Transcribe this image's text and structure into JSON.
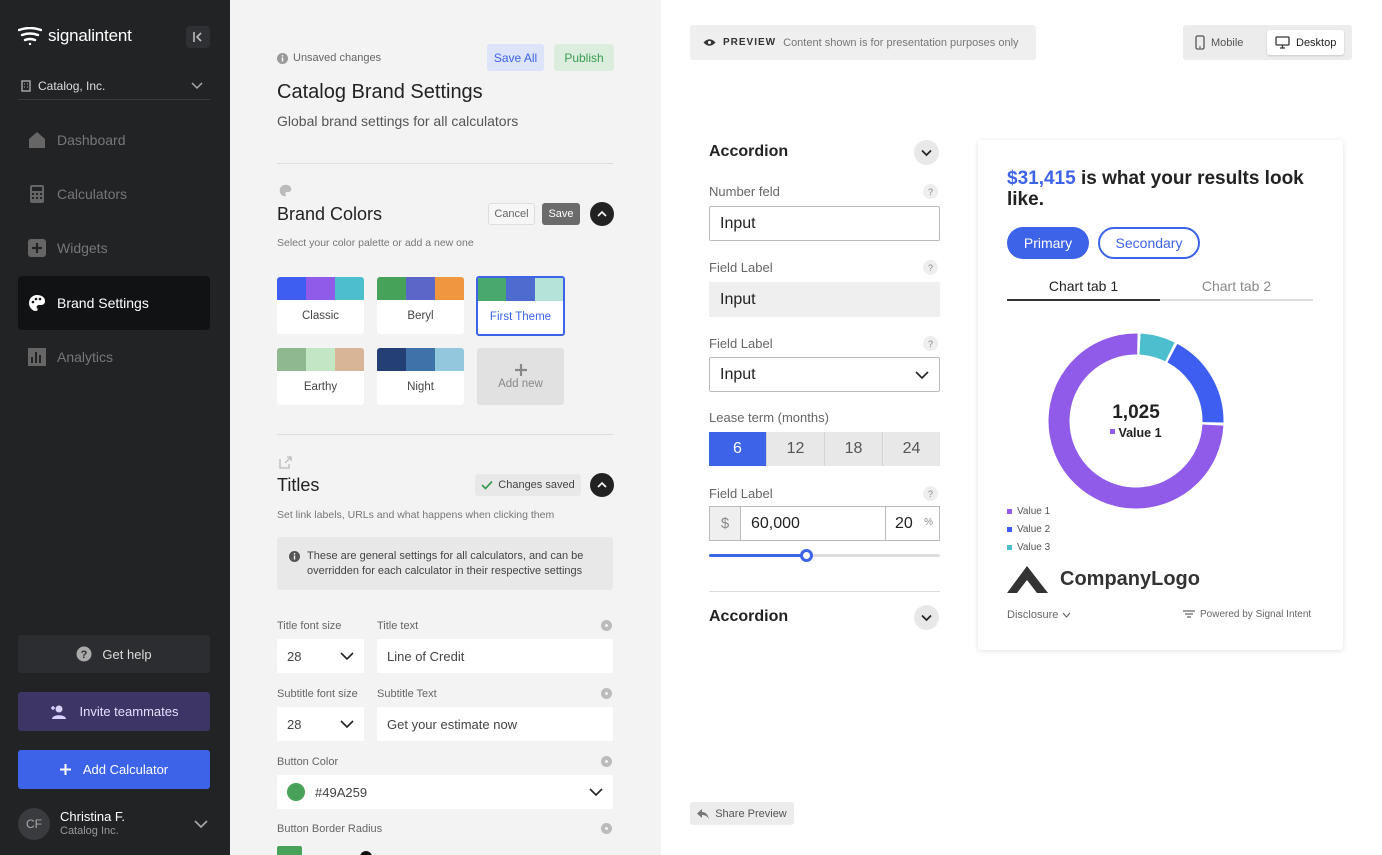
{
  "sidebar": {
    "logo_text": "signalintent",
    "org_name": "Catalog, Inc.",
    "nav": [
      {
        "label": "Dashboard",
        "icon": "home-icon"
      },
      {
        "label": "Calculators",
        "icon": "calculator-icon"
      },
      {
        "label": "Widgets",
        "icon": "plus-square-icon"
      },
      {
        "label": "Brand Settings",
        "icon": "palette-icon",
        "active": true
      },
      {
        "label": "Analytics",
        "icon": "bar-chart-icon"
      }
    ],
    "help_label": "Get help",
    "invite_label": "Invite teammates",
    "add_calculator_label": "Add Calculator",
    "user": {
      "initials": "CF",
      "name": "Christina F.",
      "org": "Catalog Inc."
    }
  },
  "settings": {
    "unsaved_label": "Unsaved changes",
    "save_all_label": "Save All",
    "publish_label": "Publish",
    "title": "Catalog Brand Settings",
    "subtitle": "Global brand settings for all calculators",
    "brand_colors": {
      "heading": "Brand Colors",
      "cancel_label": "Cancel",
      "save_label": "Save",
      "description": "Select your color palette or add a new one",
      "palettes": [
        {
          "name": "Classic",
          "colors": [
            "#3d5ef0",
            "#8f5be8",
            "#4cbfcf"
          ]
        },
        {
          "name": "Beryl",
          "colors": [
            "#47a259",
            "#5a67c9",
            "#f0963e"
          ]
        },
        {
          "name": "First Theme",
          "colors": [
            "#49a86b",
            "#4e6bd0",
            "#b3e3d9"
          ],
          "selected": true
        },
        {
          "name": "Earthy",
          "colors": [
            "#8fb790",
            "#c3e6c5",
            "#d9b597"
          ]
        },
        {
          "name": "Night",
          "colors": [
            "#233f74",
            "#3e72a8",
            "#93c7dd"
          ]
        }
      ],
      "add_new_label": "Add new"
    },
    "titles": {
      "heading": "Titles",
      "changes_saved_label": "Changes saved",
      "description": "Set link labels, URLs and what happens when clicking them",
      "info_text": "These are general settings for all calculators, and can be overridden for each calculator in their respective settings",
      "title_font_size_label": "Title font size",
      "title_font_size_value": "28",
      "title_text_label": "Title text",
      "title_text_value": "Line of Credit",
      "subtitle_font_size_label": "Subtitle font size",
      "subtitle_font_size_value": "28",
      "subtitle_text_label": "Subtitle Text",
      "subtitle_text_value": "Get your estimate now",
      "button_color_label": "Button Color",
      "button_color_value": "#49A259",
      "button_border_radius_label": "Button Border Radius"
    }
  },
  "preview": {
    "banner_label": "PREVIEW",
    "banner_note": "Content shown is for presentation purposes only",
    "mobile_label": "Mobile",
    "desktop_label": "Desktop",
    "accordion_title": "Accordion",
    "accordion_title_2": "Accordion",
    "number_field_label": "Number feld",
    "number_field_value": "Input",
    "field_label_1": "Field Label",
    "field_value_1": "Input",
    "field_label_2": "Field Label",
    "select_value": "Input",
    "lease_label": "Lease term (months)",
    "lease_options": [
      "6",
      "12",
      "18",
      "24"
    ],
    "lease_selected": "6",
    "field_label_3": "Field Label",
    "currency_symbol": "$",
    "amount_value": "60,000",
    "percent_value": "20",
    "percent_symbol": "%",
    "slider_fraction": 0.42,
    "result_amount": "$31,415",
    "result_text": " is what your results look like.",
    "primary_label": "Primary",
    "secondary_label": "Secondary",
    "chart_tab_1": "Chart tab 1",
    "chart_tab_2": "Chart tab 2",
    "company_logo_text": "CompanyLogo",
    "disclosure_label": "Disclosure",
    "powered_label": "Powered by Signal Intent",
    "share_label": "Share Preview",
    "colors": {
      "accent": "#3d63e8"
    }
  },
  "chart_data": {
    "type": "pie",
    "center_value": "1,025",
    "center_label": "Value 1",
    "categories": [
      "Value 1",
      "Value 2",
      "Value 3"
    ],
    "values": [
      75,
      18,
      7
    ],
    "colors": [
      "#8f5be8",
      "#3d5ef0",
      "#4cbfcf"
    ],
    "legend_position": "bottom-left"
  }
}
